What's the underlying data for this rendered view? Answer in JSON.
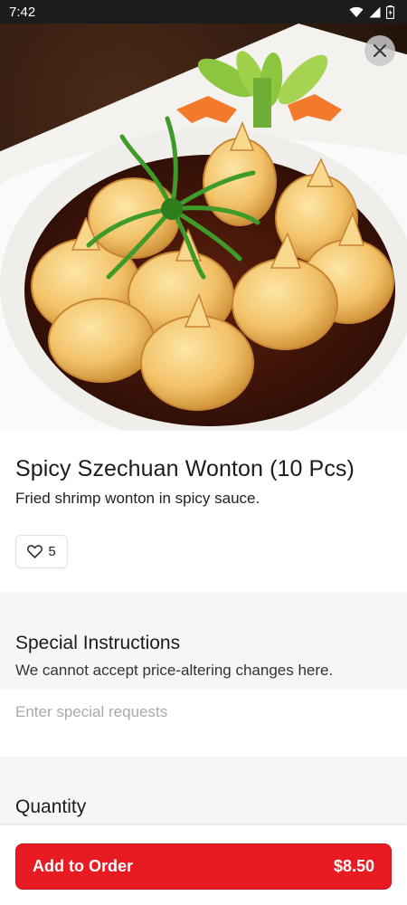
{
  "status_bar": {
    "time": "7:42",
    "icons": [
      "wifi-icon",
      "cell-signal-icon",
      "battery-icon"
    ]
  },
  "hero": {
    "image": "food-photo",
    "close_icon": "close-icon"
  },
  "item": {
    "title": "Spicy Szechuan Wonton (10 Pcs)",
    "description": "Fried shrimp wonton in spicy sauce.",
    "likes": "5",
    "like_icon": "heart-icon"
  },
  "special_instructions": {
    "title": "Special Instructions",
    "subtitle": "We cannot accept price-altering changes here.",
    "placeholder": "Enter special requests"
  },
  "quantity": {
    "title": "Quantity"
  },
  "order_button": {
    "label": "Add to Order",
    "price": "$8.50"
  },
  "colors": {
    "accent": "#e81b23",
    "section_bg": "#f6f6f8"
  }
}
